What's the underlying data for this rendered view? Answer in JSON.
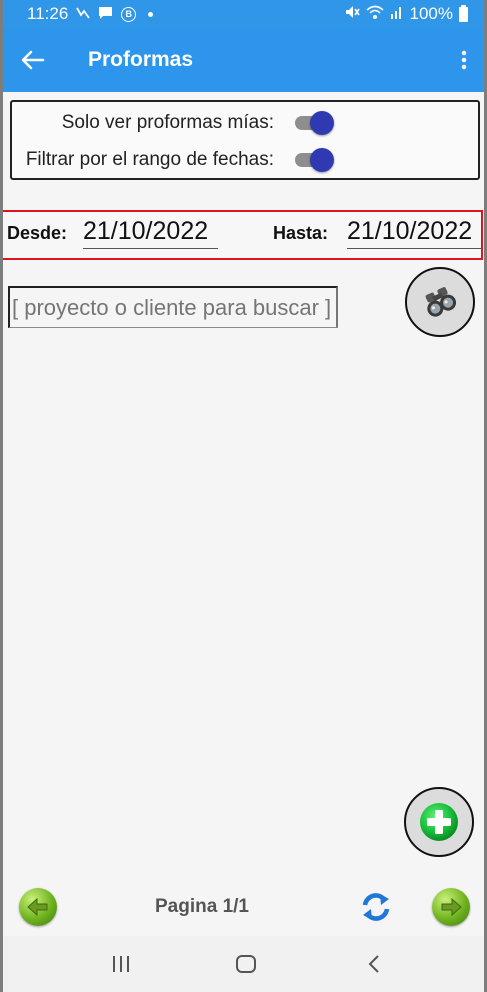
{
  "status_bar": {
    "time": "11:26",
    "left_icons": [
      "n-notification-icon",
      "chat-icon",
      "b-badge-icon",
      "dot-icon"
    ],
    "battery": "100%",
    "right_icons": [
      "mute-icon",
      "wifi-icon",
      "signal-icon",
      "battery-icon"
    ]
  },
  "app_bar": {
    "title": "Proformas",
    "back_icon": "arrow-left-icon",
    "menu_icon": "more-vertical-icon",
    "color": "#2d95ec"
  },
  "filters": {
    "only_mine": {
      "label": "Solo ver proformas mías:",
      "checked": true
    },
    "date_range": {
      "label": "Filtrar por el rango de fechas:",
      "checked": true
    },
    "toggle_color": "#2f3ab2"
  },
  "dates": {
    "from_label": "Desde:",
    "from_value": "21/10/2022",
    "to_label": "Hasta:",
    "to_value": "21/10/2022",
    "highlight_color": "#e0141e"
  },
  "search": {
    "placeholder": "[ proyecto o cliente para buscar ]",
    "value": "",
    "search_icon": "binoculars-icon"
  },
  "actions": {
    "add_icon": "plus-circle-icon"
  },
  "pagination": {
    "label": "Pagina 1/1",
    "prev_icon": "arrow-left-circle-icon",
    "next_icon": "arrow-right-circle-icon",
    "refresh_icon": "refresh-icon"
  },
  "system_nav": {
    "items": [
      "recent-apps-icon",
      "home-icon",
      "back-icon"
    ]
  }
}
